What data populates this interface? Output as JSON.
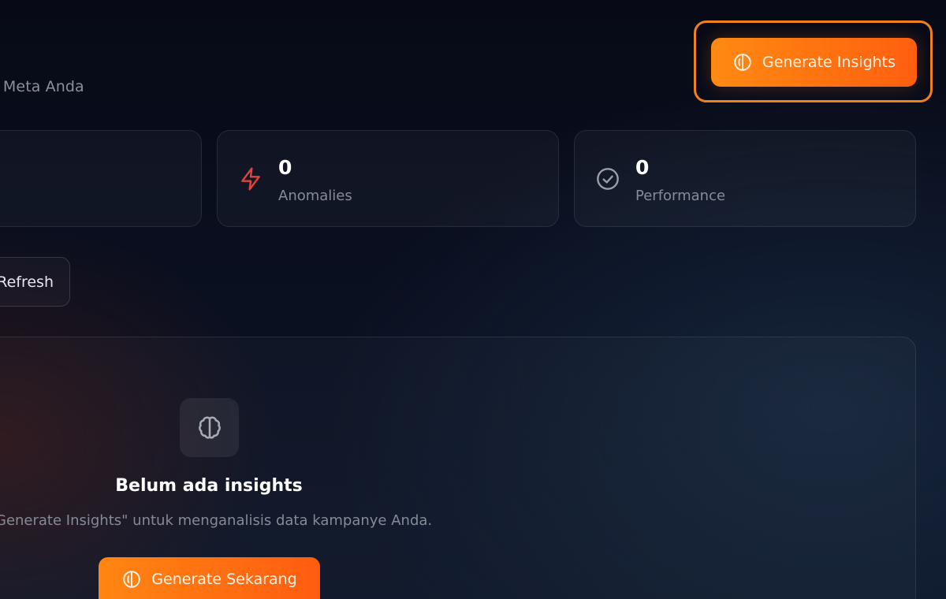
{
  "header": {
    "subtitle": "e Meta Anda",
    "generate_button_label": "Generate Insights"
  },
  "stats": [
    {
      "value": "",
      "label": "",
      "icon": "none"
    },
    {
      "value": "0",
      "label": "Anomalies",
      "icon": "zap-icon",
      "icon_color": "#e0443a"
    },
    {
      "value": "0",
      "label": "Performance",
      "icon": "check-circle-icon",
      "icon_color": "#9a9ea8"
    }
  ],
  "toolbar": {
    "refresh_label": "Refresh"
  },
  "empty_state": {
    "icon": "brain-icon",
    "title": "Belum ada insights",
    "description": "Generate Insights\" untuk menganalisis data kampanye Anda.",
    "button_label": "Generate Sekarang"
  },
  "colors": {
    "accent": "#ff7a14",
    "accent_border": "#f0801e",
    "background": "#0a0f1f"
  }
}
